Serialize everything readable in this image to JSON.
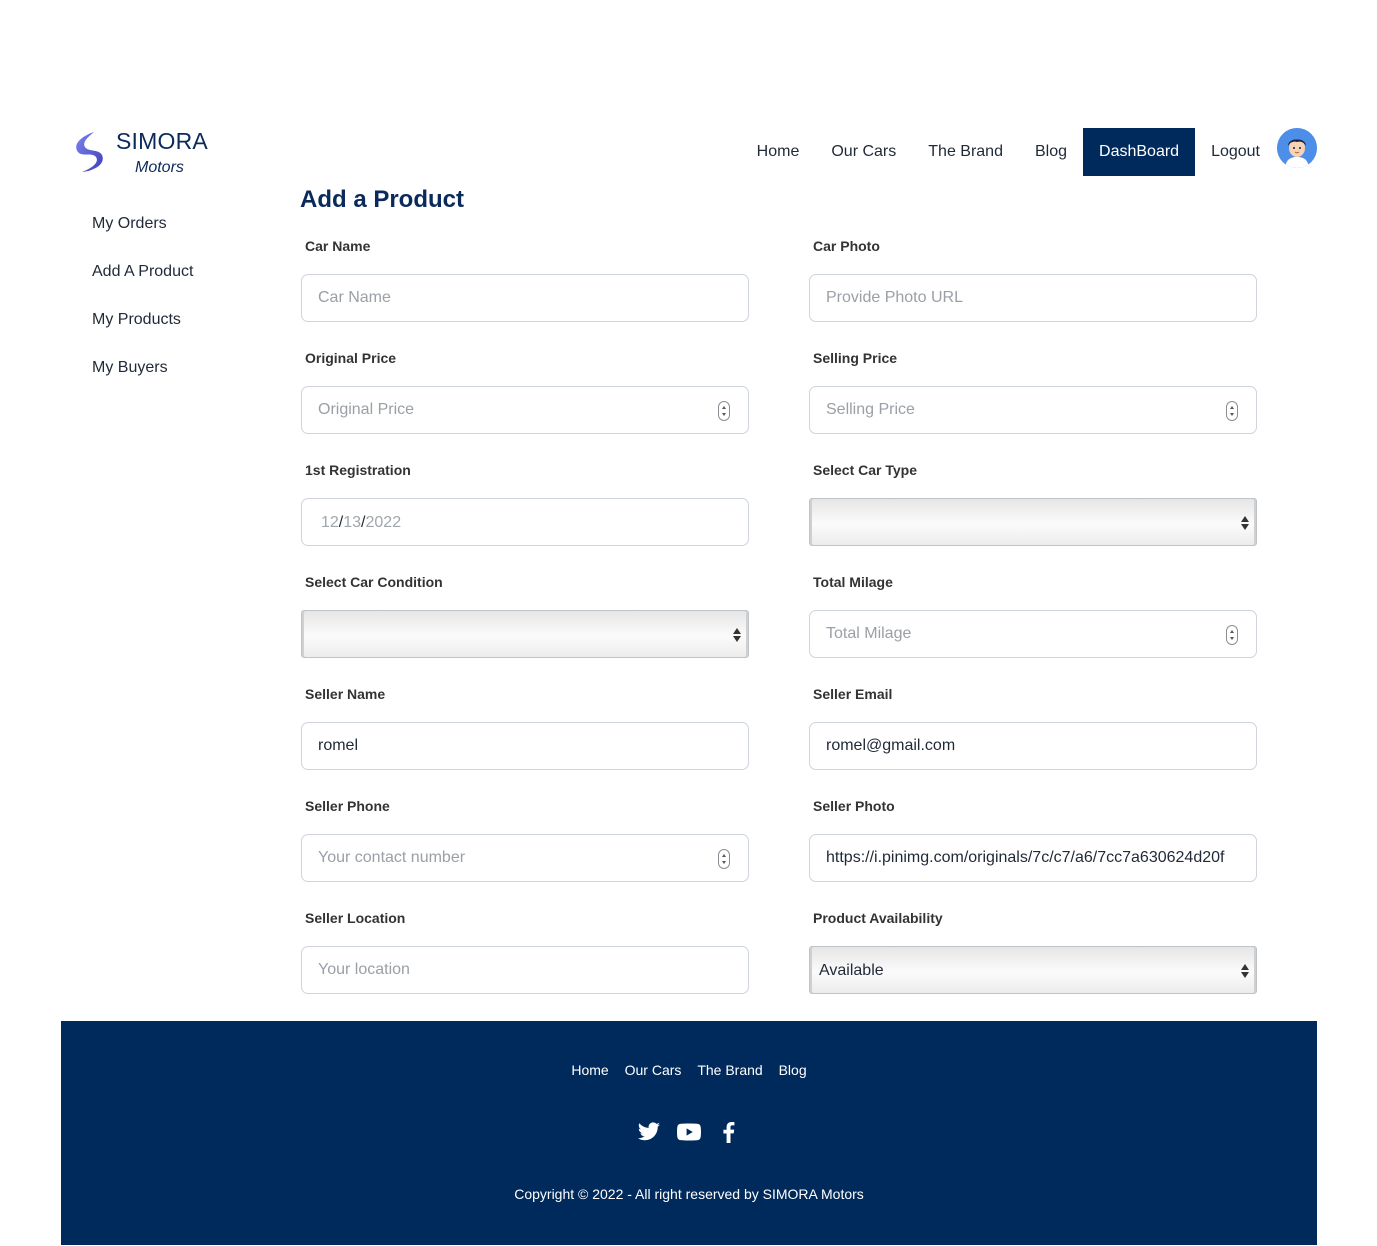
{
  "brand": {
    "name": "SIMORA",
    "tagline": "Motors"
  },
  "nav": {
    "items": [
      {
        "label": "Home"
      },
      {
        "label": "Our Cars"
      },
      {
        "label": "The Brand"
      },
      {
        "label": "Blog"
      },
      {
        "label": "DashBoard",
        "active": true
      },
      {
        "label": "Logout"
      }
    ]
  },
  "sidebar": {
    "items": [
      {
        "label": "My Orders"
      },
      {
        "label": "Add A Product"
      },
      {
        "label": "My Products"
      },
      {
        "label": "My Buyers"
      }
    ]
  },
  "form": {
    "title": "Add a Product",
    "car_name": {
      "label": "Car Name",
      "placeholder": "Car Name",
      "value": ""
    },
    "car_photo": {
      "label": "Car Photo",
      "placeholder": "Provide Photo URL",
      "value": ""
    },
    "original_price": {
      "label": "Original Price",
      "placeholder": "Original Price",
      "value": ""
    },
    "selling_price": {
      "label": "Selling Price",
      "placeholder": "Selling Price",
      "value": ""
    },
    "registration": {
      "label": "1st Registration",
      "month": "12",
      "day": "13",
      "year": "2022",
      "sep": "/"
    },
    "car_type": {
      "label": "Select Car Type",
      "value": ""
    },
    "car_condition": {
      "label": "Select Car Condition",
      "value": ""
    },
    "milage": {
      "label": "Total Milage",
      "placeholder": "Total Milage",
      "value": ""
    },
    "seller_name": {
      "label": "Seller Name",
      "value": "romel"
    },
    "seller_email": {
      "label": "Seller Email",
      "value": "romel@gmail.com"
    },
    "seller_phone": {
      "label": "Seller Phone",
      "placeholder": "Your contact number",
      "value": ""
    },
    "seller_photo": {
      "label": "Seller Photo",
      "value": "https://i.pinimg.com/originals/7c/c7/a6/7cc7a630624d20f"
    },
    "seller_location": {
      "label": "Seller Location",
      "placeholder": "Your location",
      "value": ""
    },
    "availability": {
      "label": "Product Availability",
      "value": "Available"
    }
  },
  "footer": {
    "links": [
      {
        "label": "Home"
      },
      {
        "label": "Our Cars"
      },
      {
        "label": "The Brand"
      },
      {
        "label": "Blog"
      }
    ],
    "social_icons": [
      "twitter-icon",
      "youtube-icon",
      "facebook-icon"
    ],
    "copyright": "Copyright © 2022 - All right reserved by SIMORA Motors"
  },
  "colors": {
    "primary": "#002a5c",
    "logo": "#5b5fd6",
    "avatar_bg": "#4d8fe8"
  }
}
